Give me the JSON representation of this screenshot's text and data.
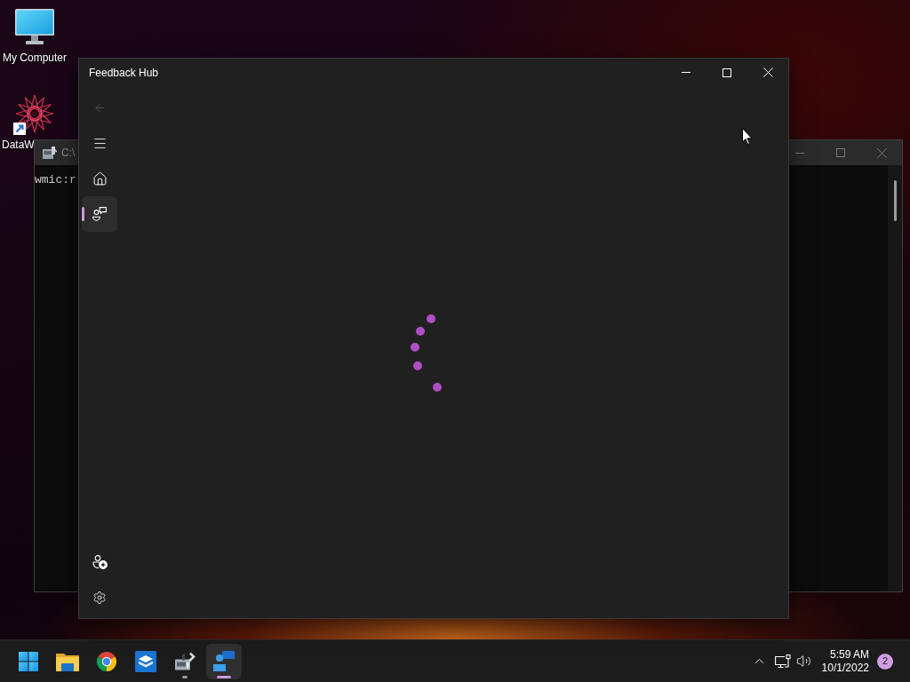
{
  "desktop_icons": [
    {
      "label": "My Computer"
    },
    {
      "label": "DataW"
    }
  ],
  "console_window": {
    "title": "C:\\",
    "text": "wmic:r"
  },
  "window": {
    "title": "Feedback Hub",
    "back": {
      "disabled": true
    },
    "nav_items": [
      {
        "selected": false
      },
      {
        "selected": true
      }
    ]
  },
  "taskbar": {
    "apps": [
      {
        "running": false,
        "selected": false
      },
      {
        "running": false,
        "selected": false
      },
      {
        "running": false,
        "selected": false
      },
      {
        "running": false,
        "selected": false
      },
      {
        "running": true,
        "selected": false
      },
      {
        "running": true,
        "selected": true
      }
    ],
    "clock": {
      "time": "5:59 AM",
      "date": "10/1/2022"
    },
    "notifications": "2"
  }
}
